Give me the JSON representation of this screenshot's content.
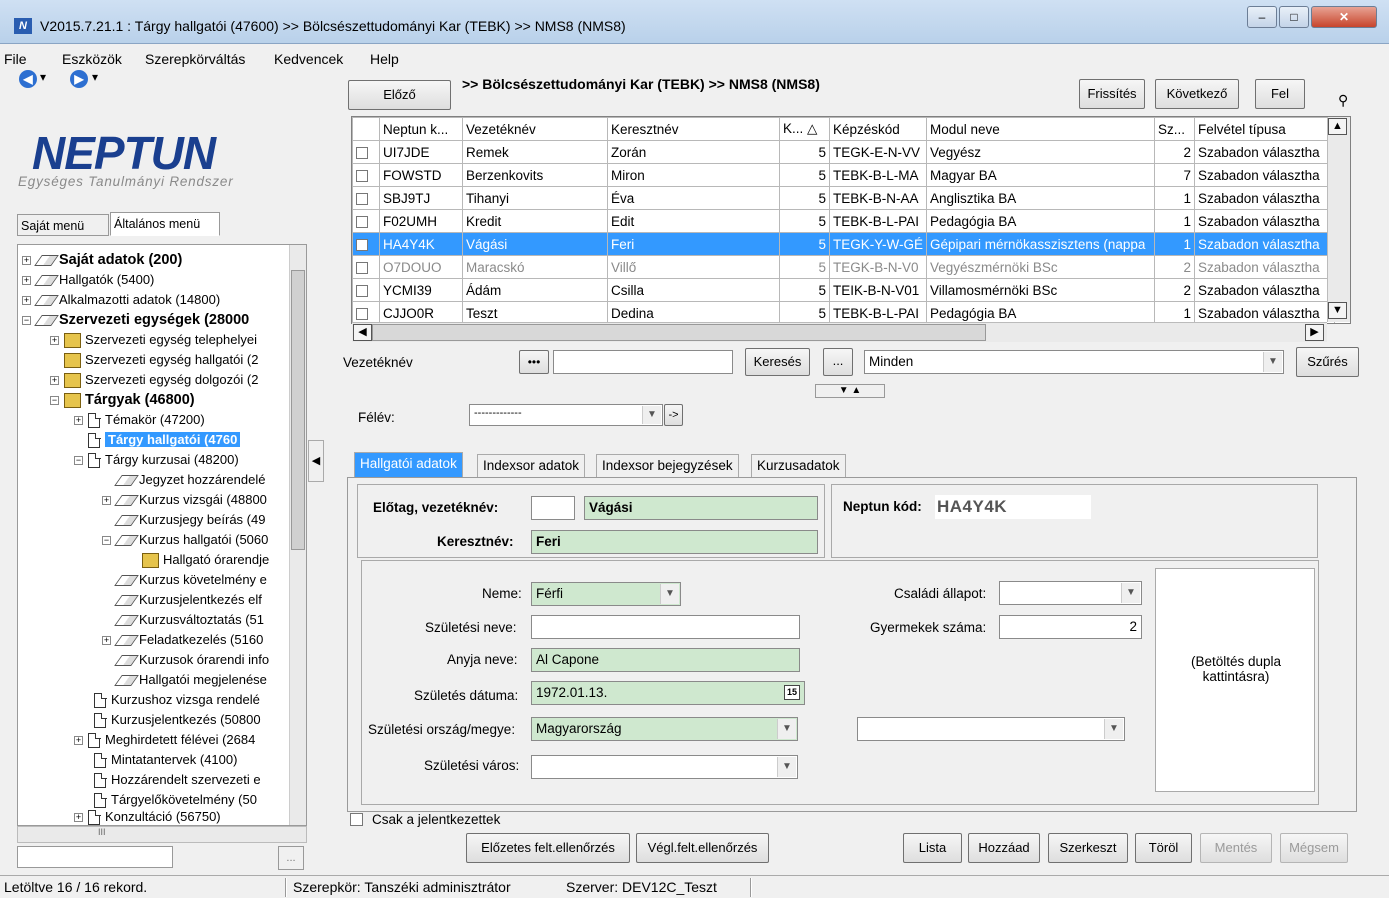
{
  "window": {
    "title": "V2015.7.21.1 : Tárgy hallgatói (47600) >> Bölcsészettudományi Kar (TEBK) >> NMS8 (NMS8)",
    "btn_min": "–",
    "btn_max": "□",
    "btn_close": "✕"
  },
  "menu": [
    "File",
    "Eszközök",
    "Szerepkörváltás",
    "Kedvencek",
    "Help"
  ],
  "nav": {
    "back": "◀",
    "forward": "▶",
    "drop": "▾"
  },
  "logo": {
    "text": "NEPTUN",
    "subtitle": "Egységes Tanulmányi Rendszer"
  },
  "left_tabs": [
    "Saját menü",
    "Általános menü"
  ],
  "tree": [
    "Saját adatok (200)",
    "Hallgatók (5400)",
    "Alkalmazotti adatok (14800)",
    "Szervezeti egységek (28000",
    "Szervezeti egység telephelyei",
    "Szervezeti egység hallgatói (2",
    "Szervezeti egység dolgozói (2",
    "Tárgyak (46800)",
    "Témakör (47200)",
    "Tárgy hallgatói (4760",
    "Tárgy kurzusai (48200)",
    "Jegyzet hozzárendelé",
    "Kurzus vizsgái (48800",
    "Kurzusjegy beírás (49",
    "Kurzus hallgatói (5060",
    "Hallgató órarendje",
    "Kurzus követelmény e",
    "Kurzusjelentkezés elf",
    "Kurzusváltoztatás (51",
    "Feladatkezelés (5160",
    "Kurzusok órarendi info",
    "Hallgatói megjelenése",
    "Kurzushoz vizsga rendelé",
    "Kurzusjelentkezés (50800",
    "Meghirdetett félévei (2684",
    "Mintatantervek (4100)",
    "Hozzárendelt szervezeti e",
    "Tárgyelőkövetelmény (50",
    "Konzultáció (56750)"
  ],
  "left_bottom": {
    "btn": "...",
    "hscroll_mark": "III"
  },
  "toolbar": {
    "prev": "Előző",
    "crumb": ">> Bölcsészettudományi Kar (TEBK) >> NMS8 (NMS8)",
    "refresh": "Frissítés",
    "next": "Következő",
    "up": "Fel",
    "pin": "⚲"
  },
  "grid": {
    "headers": [
      "Neptun k...",
      "Vezetéknév",
      "Keresztnév",
      "K... △",
      "Képzéskód",
      "Modul neve",
      "Sz...",
      "Felvétel típusa"
    ],
    "rows": [
      [
        "UI7JDE",
        "Remek",
        "Zorán",
        "5",
        "TEGK-E-N-VV",
        "Vegyész",
        "2",
        "Szabadon választha"
      ],
      [
        "FOWSTD",
        "Berzenkovits",
        "Miron",
        "5",
        "TEBK-B-L-MA",
        "Magyar BA",
        "7",
        "Szabadon választha"
      ],
      [
        "SBJ9TJ",
        "Tihanyi",
        "Éva",
        "5",
        "TEBK-B-N-AA",
        "Anglisztika BA",
        "1",
        "Szabadon választha"
      ],
      [
        "F02UMH",
        "Kredit",
        "Edit",
        "5",
        "TEBK-B-L-PAI",
        "Pedagógia BA",
        "1",
        "Szabadon választha"
      ],
      [
        "HA4Y4K",
        "Vágási",
        "Feri",
        "5",
        "TEGK-Y-W-GÉ",
        "Gépipari mérnökasszisztens (nappa",
        "1",
        "Szabadon választha"
      ],
      [
        "O7DOUO",
        "Maracskó",
        "Villő",
        "5",
        "TEGK-B-N-V0",
        "Vegyészmérnöki BSc",
        "2",
        "Szabadon választha"
      ],
      [
        "YCMI39",
        "Ádám",
        "Csilla",
        "5",
        "TEIK-B-N-V01",
        "Villamosmérnöki BSc",
        "2",
        "Szabadon választha"
      ],
      [
        "CJJO0R",
        "Teszt",
        "Dedina",
        "5",
        "TEBK-B-L-PAI",
        "Pedagógia BA",
        "1",
        "Szabadon választha"
      ]
    ]
  },
  "search": {
    "label": "Vezetéknév",
    "dots": "•••",
    "value": "",
    "btn": "Keresés",
    "more": "...",
    "filter_value": "Minden",
    "filter_btn": "Szűrés"
  },
  "semester": {
    "label": "Félév:",
    "value": "-------------",
    "arrow": "->"
  },
  "tabs": [
    "Hallgatói adatok",
    "Indexsor adatok",
    "Indexsor bejegyzések",
    "Kurzusadatok"
  ],
  "form": {
    "prefix_label": "Előtag, vezetéknév:",
    "prefix_value": "",
    "surname_value": "Vágási",
    "firstname_label": "Keresztnév:",
    "firstname_value": "Feri",
    "neptun_label": "Neptun kód:",
    "neptun_value": "HA4Y4K",
    "gender_label": "Neme:",
    "gender_value": "Férfi",
    "birthname_label": "Születési neve:",
    "birthname_value": "",
    "mother_label": "Anyja neve:",
    "mother_value": "Al Capone",
    "birthdate_label": "Születés dátuma:",
    "birthdate_value": "1972.01.13.",
    "cal_icon": "15",
    "country_label": "Születési ország/megye:",
    "country_value": "Magyarország",
    "city_label": "Születési város:",
    "city_value": "",
    "marital_label": "Családi állapot:",
    "marital_value": "",
    "children_label": "Gyermekek száma:",
    "children_value": "2",
    "county_value": "",
    "photo_hint": "(Betöltés dupla kattintásra)"
  },
  "bottom": {
    "only_registered": "Csak a jelentkezettek",
    "pre_check": "Előzetes felt.ellenőrzés",
    "final_check": "Végl.felt.ellenőrzés",
    "list": "Lista",
    "add": "Hozzáad",
    "edit": "Szerkeszt",
    "delete": "Töröl",
    "save": "Mentés",
    "cancel": "Mégsem"
  },
  "status": {
    "records": "Letöltve 16 / 16 rekord.",
    "role": "Szerepkör: Tanszéki adminisztrátor",
    "server": "Szerver: DEV12C_Teszt"
  }
}
